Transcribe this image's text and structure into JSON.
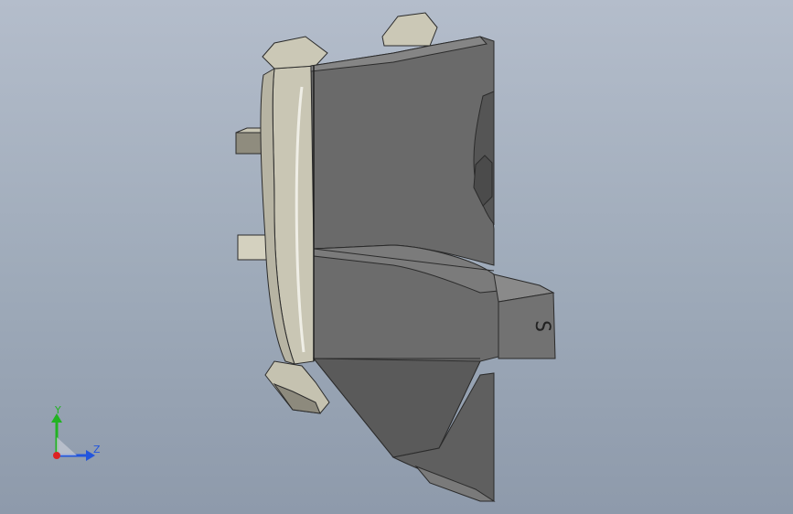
{
  "viewport": {
    "background_top": "#b4bdcb",
    "background_bottom": "#8e9aab"
  },
  "model": {
    "engraved_text": "S",
    "colors": {
      "body_dark": "#5f5f5f",
      "body_mid": "#6e6e6e",
      "body_light": "#7a7a7a",
      "flange": "#c9c6b4",
      "flange_shadow": "#a9a696",
      "edge": "#2b2b2b"
    }
  },
  "triad": {
    "x_label": "",
    "y_label": "Y",
    "z_label": "Z",
    "y_color": "#22b322",
    "z_color": "#2255dd",
    "x_color": "#dd2222"
  }
}
